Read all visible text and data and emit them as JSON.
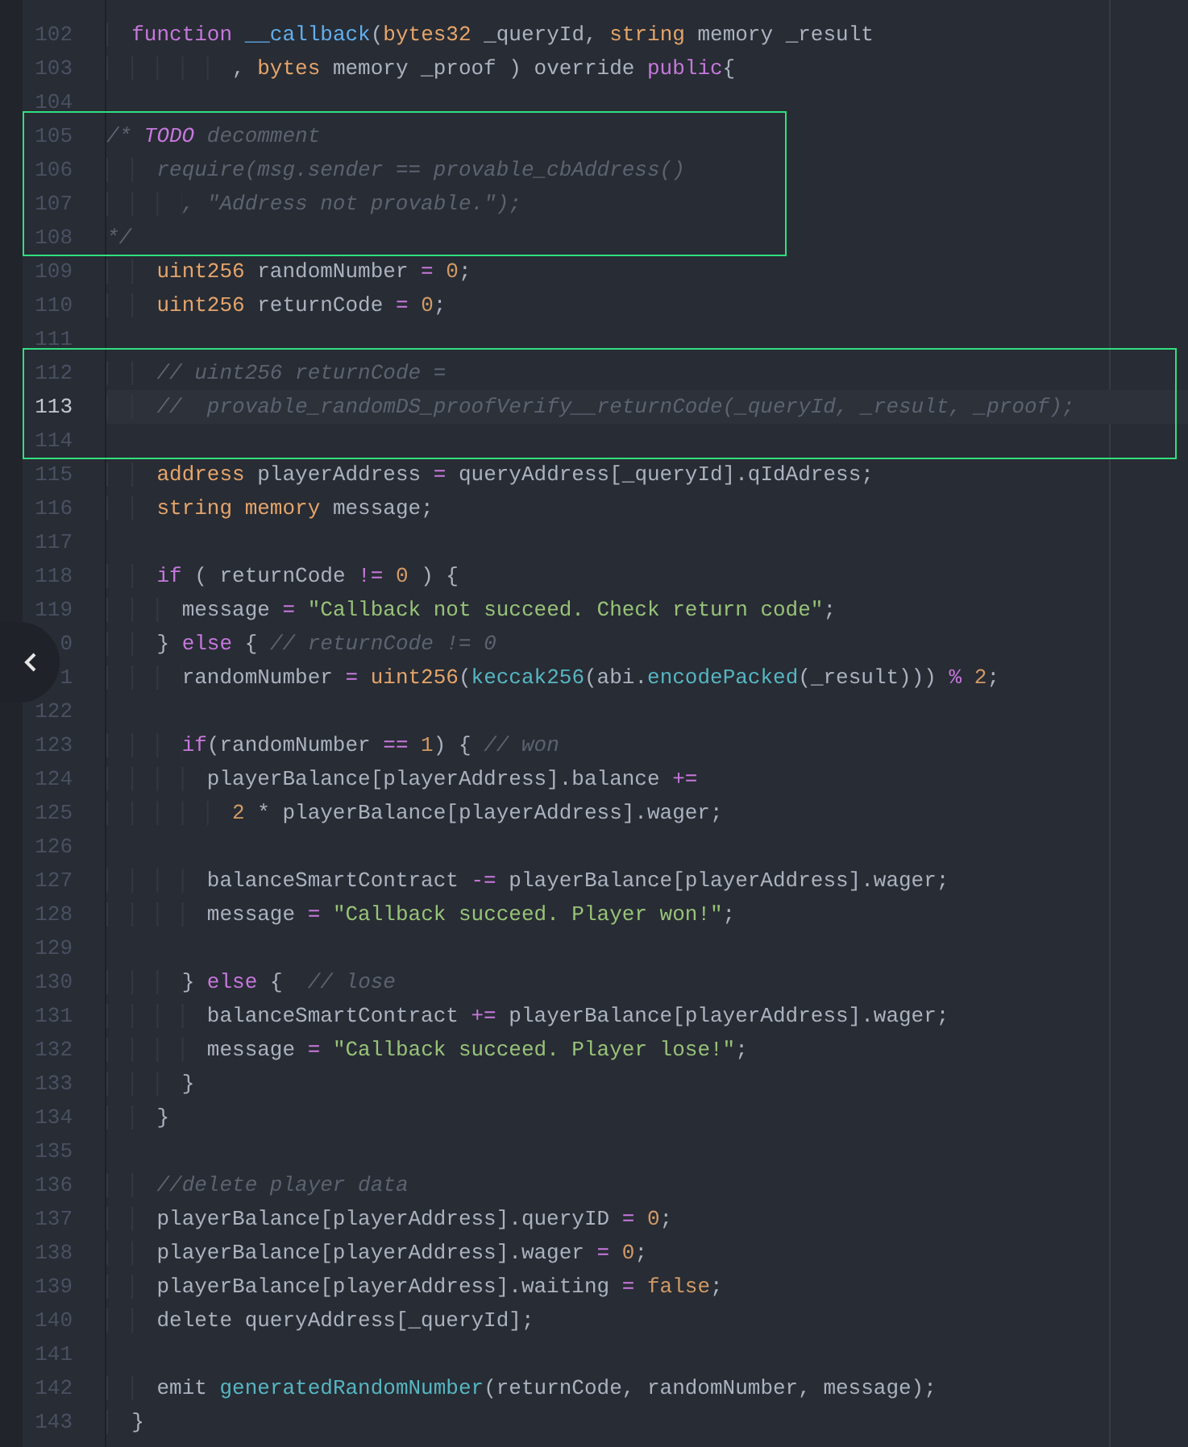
{
  "editor": {
    "blocks": [
      {
        "kind": "plain",
        "lines": [
          {
            "number": "102",
            "current": false,
            "code": [
              {
                "kind": "keyword",
                "text": "  function"
              },
              {
                "kind": "function",
                "text": " __callback"
              },
              {
                "kind": "plain",
                "text": "("
              },
              {
                "kind": "type",
                "text": "bytes32"
              },
              {
                "kind": "plain",
                "text": " _queryId, "
              },
              {
                "kind": "type",
                "text": "string"
              },
              {
                "kind": "plain",
                "text": " memory _result"
              }
            ]
          },
          {
            "number": "103",
            "current": false,
            "code": [
              {
                "kind": "plain",
                "text": "          , "
              },
              {
                "kind": "type",
                "text": "bytes"
              },
              {
                "kind": "plain",
                "text": " memory _proof ) override "
              },
              {
                "kind": "keyword",
                "text": "public"
              },
              {
                "kind": "plain",
                "text": "{"
              }
            ]
          },
          {
            "number": "104",
            "current": false
          }
        ]
      },
      {
        "kind": "boxed",
        "lines": [
          {
            "number": "105",
            "current": false,
            "code": [
              {
                "kind": "comment",
                "text": "/* "
              },
              {
                "kind": "todo",
                "text": "TODO"
              },
              {
                "kind": "comment",
                "text": " decomment"
              }
            ]
          },
          {
            "number": "106",
            "current": false,
            "code": [
              {
                "kind": "comment",
                "text": "    require(msg.sender == provable_cbAddress()"
              }
            ]
          },
          {
            "number": "107",
            "current": false,
            "code": [
              {
                "kind": "comment",
                "text": "      , \"Address not provable.\");"
              }
            ]
          },
          {
            "number": "108",
            "current": false,
            "code": [
              {
                "kind": "comment",
                "text": "*/"
              }
            ]
          }
        ]
      },
      {
        "kind": "plain",
        "lines": [
          {
            "number": "109",
            "current": false,
            "code": [
              {
                "kind": "type",
                "text": "    uint256"
              },
              {
                "kind": "plain",
                "text": " randomNumber "
              },
              {
                "kind": "operator",
                "text": "="
              },
              {
                "kind": "number",
                "text": " 0"
              },
              {
                "kind": "plain",
                "text": ";"
              }
            ]
          },
          {
            "number": "110",
            "current": false,
            "code": [
              {
                "kind": "type",
                "text": "    uint256"
              },
              {
                "kind": "plain",
                "text": " returnCode "
              },
              {
                "kind": "operator",
                "text": "="
              },
              {
                "kind": "number",
                "text": " 0"
              },
              {
                "kind": "plain",
                "text": ";"
              }
            ]
          },
          {
            "number": "111",
            "current": false
          }
        ]
      },
      {
        "kind": "boxed",
        "lines": [
          {
            "number": "112",
            "current": false,
            "code": [
              {
                "kind": "comment",
                "text": "    // uint256 returnCode ="
              }
            ]
          },
          {
            "number": "113",
            "current": true,
            "code": [
              {
                "kind": "comment",
                "text": "    //  provable_randomDS_proofVerify__returnCode(_queryId, _result, _proof);"
              }
            ]
          },
          {
            "number": "114",
            "current": false
          }
        ]
      },
      {
        "kind": "plain",
        "lines": [
          {
            "number": "115",
            "current": false,
            "code": [
              {
                "kind": "type",
                "text": "    address"
              },
              {
                "kind": "plain",
                "text": " playerAddress "
              },
              {
                "kind": "operator",
                "text": "="
              },
              {
                "kind": "plain",
                "text": " queryAddress[_queryId].qIdAdress;"
              }
            ]
          },
          {
            "number": "116",
            "current": false,
            "code": [
              {
                "kind": "type",
                "text": "    string"
              },
              {
                "kind": "type",
                "text": " memory"
              },
              {
                "kind": "plain",
                "text": " message;"
              }
            ]
          },
          {
            "number": "117",
            "current": false
          },
          {
            "number": "118",
            "current": false,
            "code": [
              {
                "kind": "keyword",
                "text": "    if"
              },
              {
                "kind": "plain",
                "text": " ( returnCode "
              },
              {
                "kind": "operator",
                "text": "!="
              },
              {
                "kind": "number",
                "text": " 0"
              },
              {
                "kind": "plain",
                "text": " ) {"
              }
            ]
          },
          {
            "number": "119",
            "current": false,
            "code": [
              {
                "kind": "plain",
                "text": "      message "
              },
              {
                "kind": "operator",
                "text": "="
              },
              {
                "kind": "string",
                "text": " \"Callback not succeed. Check return code\""
              },
              {
                "kind": "plain",
                "text": ";"
              }
            ]
          },
          {
            "number": "0",
            "current": false,
            "code": [
              {
                "kind": "plain",
                "text": "    } "
              },
              {
                "kind": "keyword",
                "text": "else"
              },
              {
                "kind": "plain",
                "text": " { "
              },
              {
                "kind": "comment",
                "text": "// returnCode != 0"
              }
            ]
          },
          {
            "number": "1",
            "current": false,
            "code": [
              {
                "kind": "plain",
                "text": "      randomNumber "
              },
              {
                "kind": "operator",
                "text": "="
              },
              {
                "kind": "type",
                "text": " uint256"
              },
              {
                "kind": "plain",
                "text": "("
              },
              {
                "kind": "builtin",
                "text": "keccak256"
              },
              {
                "kind": "plain",
                "text": "(abi."
              },
              {
                "kind": "builtin",
                "text": "encodePacked"
              },
              {
                "kind": "plain",
                "text": "(_result))) "
              },
              {
                "kind": "operator",
                "text": "%"
              },
              {
                "kind": "number",
                "text": " 2"
              },
              {
                "kind": "plain",
                "text": ";"
              }
            ]
          },
          {
            "number": "122",
            "current": false
          },
          {
            "number": "123",
            "current": false,
            "code": [
              {
                "kind": "keyword",
                "text": "      if"
              },
              {
                "kind": "plain",
                "text": "(randomNumber "
              },
              {
                "kind": "operator",
                "text": "=="
              },
              {
                "kind": "number",
                "text": " 1"
              },
              {
                "kind": "plain",
                "text": ") { "
              },
              {
                "kind": "comment",
                "text": "// won"
              }
            ]
          },
          {
            "number": "124",
            "current": false,
            "code": [
              {
                "kind": "plain",
                "text": "        playerBalance[playerAddress].balance "
              },
              {
                "kind": "operator",
                "text": "+="
              }
            ]
          },
          {
            "number": "125",
            "current": false,
            "code": [
              {
                "kind": "number",
                "text": "          2"
              },
              {
                "kind": "plain",
                "text": " * playerBalance[playerAddress].wager;"
              }
            ]
          },
          {
            "number": "126",
            "current": false
          },
          {
            "number": "127",
            "current": false,
            "code": [
              {
                "kind": "plain",
                "text": "        balanceSmartContract "
              },
              {
                "kind": "operator",
                "text": "-="
              },
              {
                "kind": "plain",
                "text": " playerBalance[playerAddress].wager;"
              }
            ]
          },
          {
            "number": "128",
            "current": false,
            "code": [
              {
                "kind": "plain",
                "text": "        message "
              },
              {
                "kind": "operator",
                "text": "="
              },
              {
                "kind": "string",
                "text": " \"Callback succeed. Player won!\""
              },
              {
                "kind": "plain",
                "text": ";"
              }
            ]
          },
          {
            "number": "129",
            "current": false
          },
          {
            "number": "130",
            "current": false,
            "code": [
              {
                "kind": "plain",
                "text": "      } "
              },
              {
                "kind": "keyword",
                "text": "else"
              },
              {
                "kind": "plain",
                "text": " {  "
              },
              {
                "kind": "comment",
                "text": "// lose"
              }
            ]
          },
          {
            "number": "131",
            "current": false,
            "code": [
              {
                "kind": "plain",
                "text": "        balanceSmartContract "
              },
              {
                "kind": "operator",
                "text": "+="
              },
              {
                "kind": "plain",
                "text": " playerBalance[playerAddress].wager;"
              }
            ]
          },
          {
            "number": "132",
            "current": false,
            "code": [
              {
                "kind": "plain",
                "text": "        message "
              },
              {
                "kind": "operator",
                "text": "="
              },
              {
                "kind": "string",
                "text": " \"Callback succeed. Player lose!\""
              },
              {
                "kind": "plain",
                "text": ";"
              }
            ]
          },
          {
            "number": "133",
            "current": false,
            "code": [
              {
                "kind": "plain",
                "text": "      }"
              }
            ]
          },
          {
            "number": "134",
            "current": false,
            "code": [
              {
                "kind": "plain",
                "text": "    }"
              }
            ]
          },
          {
            "number": "135",
            "current": false
          },
          {
            "number": "136",
            "current": false,
            "code": [
              {
                "kind": "comment",
                "text": "    //delete player data"
              }
            ]
          },
          {
            "number": "137",
            "current": false,
            "code": [
              {
                "kind": "plain",
                "text": "    playerBalance[playerAddress].queryID "
              },
              {
                "kind": "operator",
                "text": "="
              },
              {
                "kind": "number",
                "text": " 0"
              },
              {
                "kind": "plain",
                "text": ";"
              }
            ]
          },
          {
            "number": "138",
            "current": false,
            "code": [
              {
                "kind": "plain",
                "text": "    playerBalance[playerAddress].wager "
              },
              {
                "kind": "operator",
                "text": "="
              },
              {
                "kind": "number",
                "text": " 0"
              },
              {
                "kind": "plain",
                "text": ";"
              }
            ]
          },
          {
            "number": "139",
            "current": false,
            "code": [
              {
                "kind": "plain",
                "text": "    playerBalance[playerAddress].waiting "
              },
              {
                "kind": "operator",
                "text": "="
              },
              {
                "kind": "number",
                "text": " false"
              },
              {
                "kind": "plain",
                "text": ";"
              }
            ]
          },
          {
            "number": "140",
            "current": false,
            "code": [
              {
                "kind": "plain",
                "text": "    delete queryAddress[_queryId];"
              }
            ]
          },
          {
            "number": "141",
            "current": false
          },
          {
            "number": "142",
            "current": false,
            "code": [
              {
                "kind": "plain",
                "text": "    emit "
              },
              {
                "kind": "builtin",
                "text": "generatedRandomNumber"
              },
              {
                "kind": "plain",
                "text": "(returnCode, randomNumber, message);"
              }
            ]
          },
          {
            "number": "143",
            "current": false,
            "code": [
              {
                "kind": "plain",
                "text": "  }"
              }
            ]
          }
        ]
      }
    ]
  }
}
